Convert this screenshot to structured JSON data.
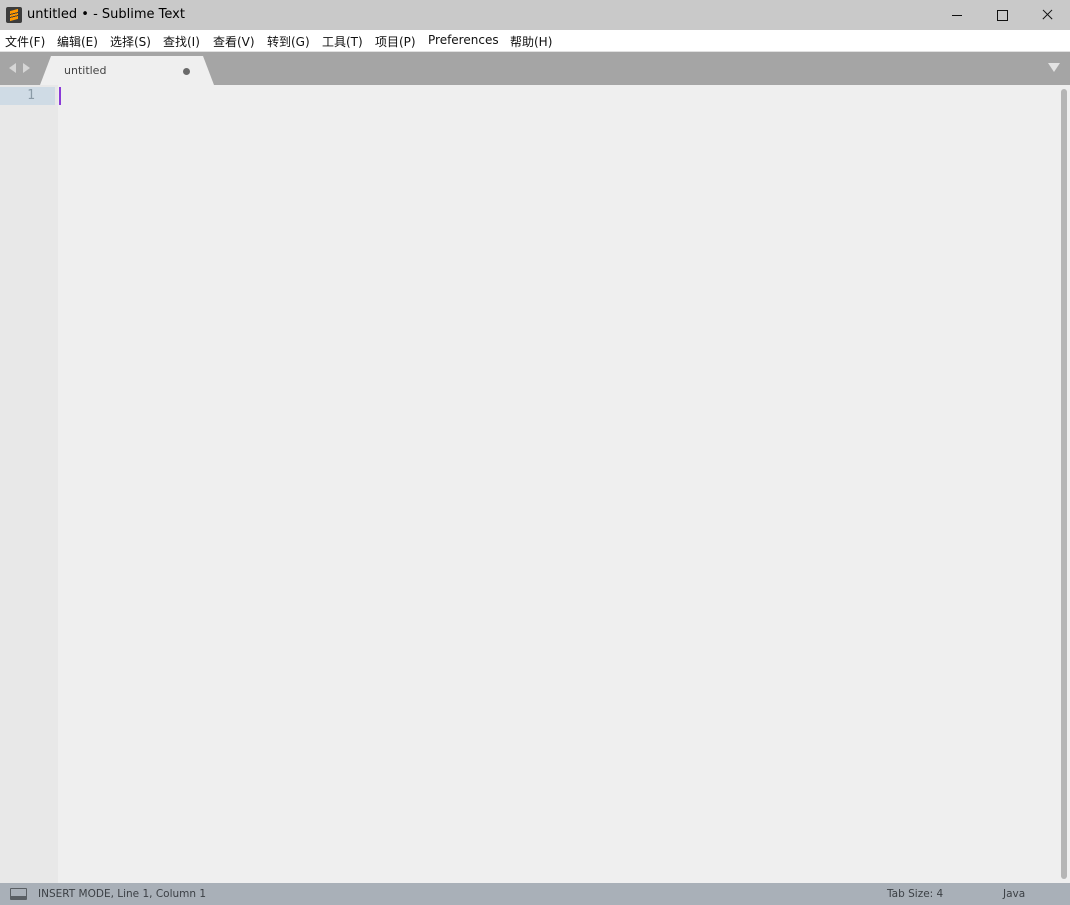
{
  "window": {
    "title": "untitled • - Sublime Text"
  },
  "menu": {
    "items": [
      {
        "label": "文件(F)"
      },
      {
        "label": "编辑(E)"
      },
      {
        "label": "选择(S)"
      },
      {
        "label": "查找(I)"
      },
      {
        "label": "查看(V)"
      },
      {
        "label": "转到(G)"
      },
      {
        "label": "工具(T)"
      },
      {
        "label": "项目(P)"
      },
      {
        "label": "Preferences"
      },
      {
        "label": "帮助(H)"
      }
    ]
  },
  "tabs": [
    {
      "label": "untitled",
      "modified": true
    }
  ],
  "editor": {
    "line_numbers": [
      "1"
    ],
    "content": ""
  },
  "status": {
    "mode": "INSERT MODE, Line 1, Column 1",
    "tab_size": "Tab Size: 4",
    "syntax": "Java"
  },
  "icons": {
    "app": "sublime-text-icon",
    "minimize": "minimize-icon",
    "maximize": "maximize-icon",
    "close": "close-icon",
    "tab_modified": "dot-icon",
    "tab_list": "triangle-down-icon",
    "panel": "panel-icon"
  },
  "colors": {
    "caret": "#8a3ad8",
    "status_bar": "#a9b0b8",
    "tab_bar": "#a5a5a5",
    "current_line_gutter": "#cfdbe5"
  }
}
